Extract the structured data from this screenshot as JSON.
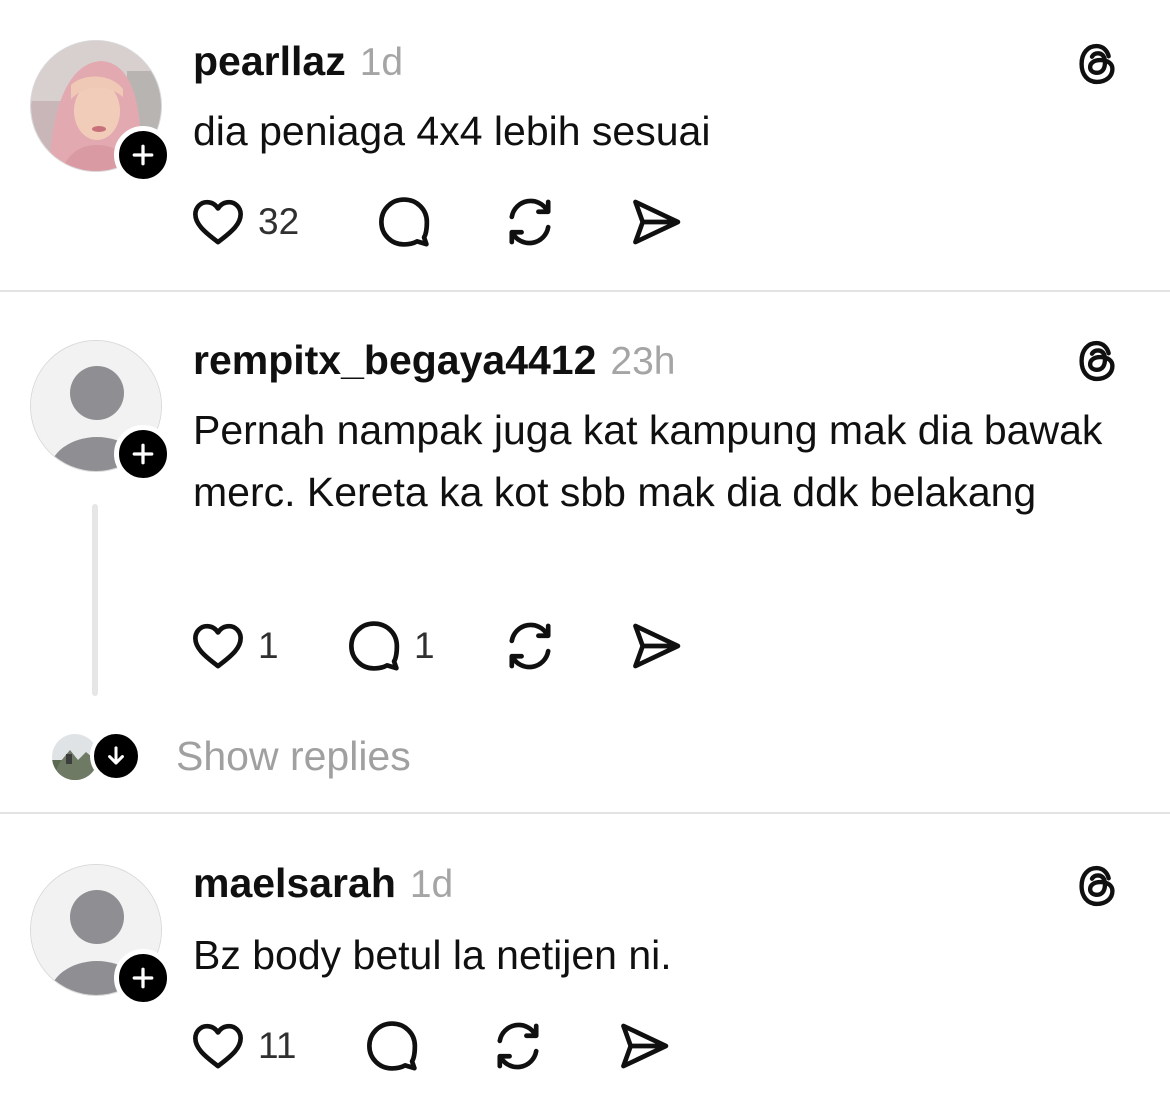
{
  "posts": [
    {
      "username": "pearllaz",
      "time": "1d",
      "text": "dia peniaga 4x4 lebih sesuai",
      "likes": "32",
      "replies": "",
      "avatar_type": "photo"
    },
    {
      "username": "rempitx_begaya4412",
      "time": "23h",
      "text": "Pernah nampak juga kat kampung mak dia bawak merc. Kereta ka kot sbb mak dia ddk belakang",
      "likes": "1",
      "replies": "1",
      "avatar_type": "default"
    },
    {
      "username": "maelsarah",
      "time": "1d",
      "text": "Bz body betul la netijen ni.",
      "likes": "11",
      "replies": "",
      "avatar_type": "default"
    }
  ],
  "show_replies": {
    "label": "Show replies"
  },
  "icons": {
    "like": "heart-icon",
    "reply": "comment-icon",
    "repost": "repost-icon",
    "share": "send-icon",
    "follow": "plus-icon",
    "brand": "threads-logo-icon",
    "expand": "arrow-down-icon"
  },
  "colors": {
    "text": "#101010",
    "muted": "#a5a5a5",
    "divider": "#e3e3e3",
    "badge": "#000000"
  }
}
